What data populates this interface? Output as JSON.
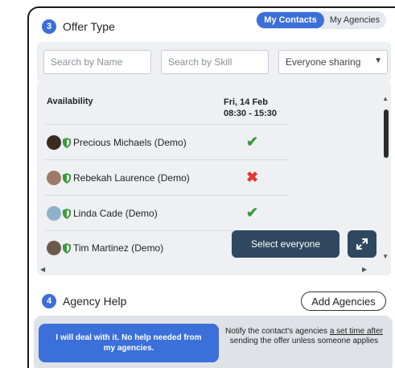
{
  "offer_type": {
    "step": "3",
    "title": "Offer Type",
    "toggle": {
      "my_contacts": "My Contacts",
      "my_agencies": "My Agencies"
    }
  },
  "filters": {
    "search_name_placeholder": "Search by Name",
    "search_skill_placeholder": "Search by Skill",
    "sharing_select": "Everyone sharing"
  },
  "table": {
    "availability_header": "Availability",
    "date_line1": "Fri, 14 Feb",
    "date_line2": "08:30 - 15:30",
    "rows": [
      {
        "name": "Precious Michaels (Demo)",
        "status": "✔",
        "available": true
      },
      {
        "name": "Rebekah Laurence (Demo)",
        "status": "✖",
        "available": false
      },
      {
        "name": "Linda Cade (Demo)",
        "status": "✔",
        "available": true
      },
      {
        "name": "Tim Martinez (Demo)",
        "status": "",
        "available": null
      }
    ]
  },
  "actions": {
    "select_everyone": "Select everyone"
  },
  "agency_help": {
    "step": "4",
    "title": "Agency Help",
    "add_agencies": "Add Agencies",
    "option_primary": "I will deal with it. No help needed from my agencies.",
    "option_secondary_pre": "Notify the contact's agencies ",
    "option_secondary_link": "a set time after",
    "option_secondary_post": " sending the offer unless someone applies"
  },
  "colors": {
    "accent": "#3b6fd9",
    "dark_button": "#2f4860",
    "available": "#3b9a3b",
    "unavailable": "#e0362f",
    "panel_bg": "#eef0f3"
  }
}
